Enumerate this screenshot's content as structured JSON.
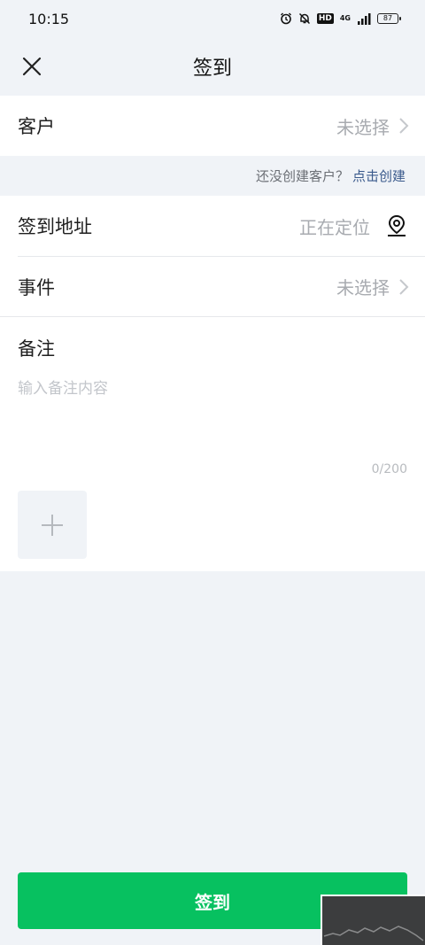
{
  "status_bar": {
    "time": "10:15",
    "hd": "HD",
    "network": "4G",
    "battery": "87",
    "icons": [
      "alarm-icon",
      "bell-off-icon",
      "hd-icon",
      "signal-icon",
      "battery-icon"
    ]
  },
  "nav": {
    "title": "签到",
    "close_icon": "close-icon"
  },
  "customer": {
    "label": "客户",
    "value": "未选择"
  },
  "hint": {
    "text": "还没创建客户？",
    "link": "点击创建"
  },
  "address": {
    "label": "签到地址",
    "value": "正在定位"
  },
  "event": {
    "label": "事件",
    "value": "未选择"
  },
  "notes": {
    "label": "备注",
    "placeholder": "输入备注内容",
    "counter": "0/200"
  },
  "submit": {
    "label": "签到"
  },
  "colors": {
    "primary": "#07c160",
    "link": "#3a5a8c",
    "background": "#f0f3f7"
  }
}
